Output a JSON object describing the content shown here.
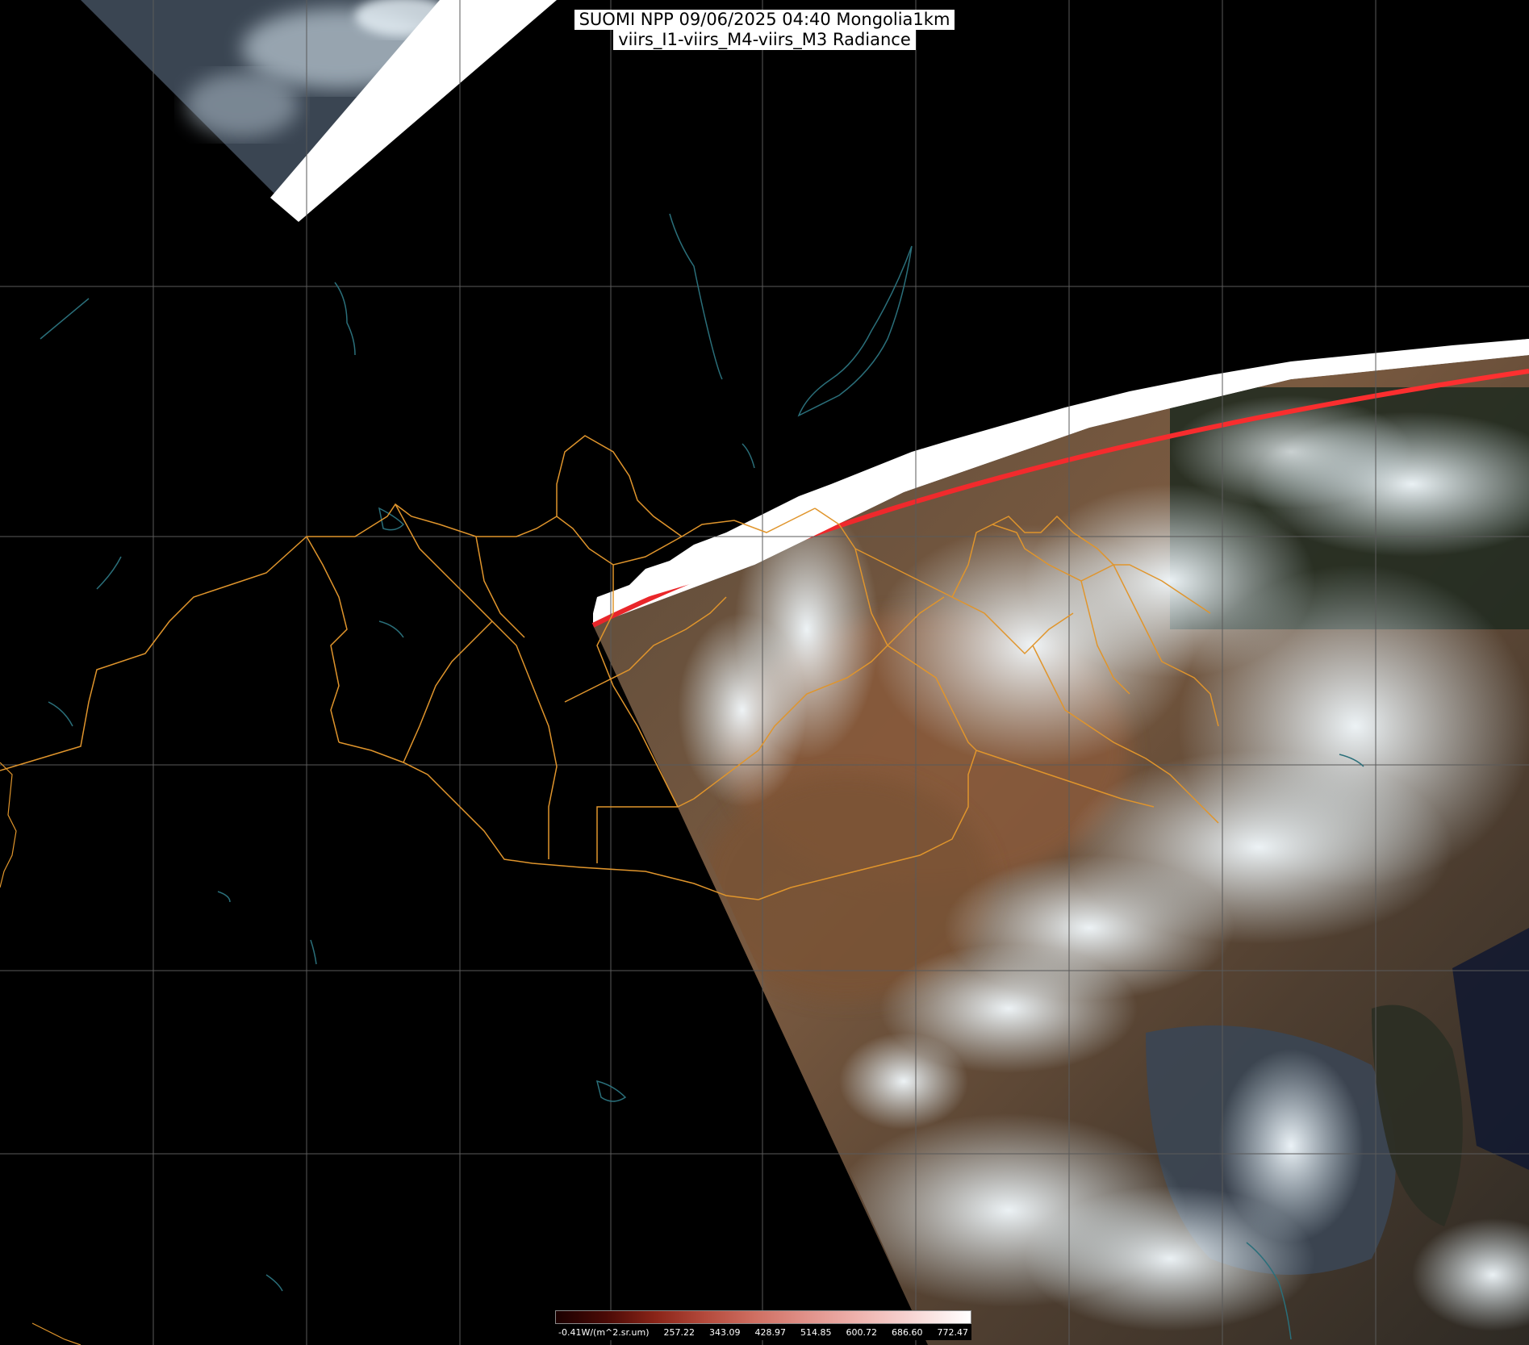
{
  "title": {
    "line1": "SUOMI NPP 09/06/2025 04:40 Mongolia1km",
    "line2": "viirs_I1-viirs_M4-viirs_M3 Radiance"
  },
  "colorbar": {
    "unit_label": "-0.41W/(m^2.sr.um)",
    "ticks": [
      "257.22",
      "343.09",
      "428.97",
      "514.85",
      "600.72",
      "686.60",
      "772.47"
    ]
  },
  "colors": {
    "background": "#000000",
    "graticule": "#5a5a5a",
    "borders": "#e0952c",
    "water": "#2a6f7a",
    "swath_edge": "#e8262a"
  },
  "layers": [
    "graticule",
    "province-borders",
    "lakes-rivers",
    "satellite-swath",
    "colorbar"
  ]
}
